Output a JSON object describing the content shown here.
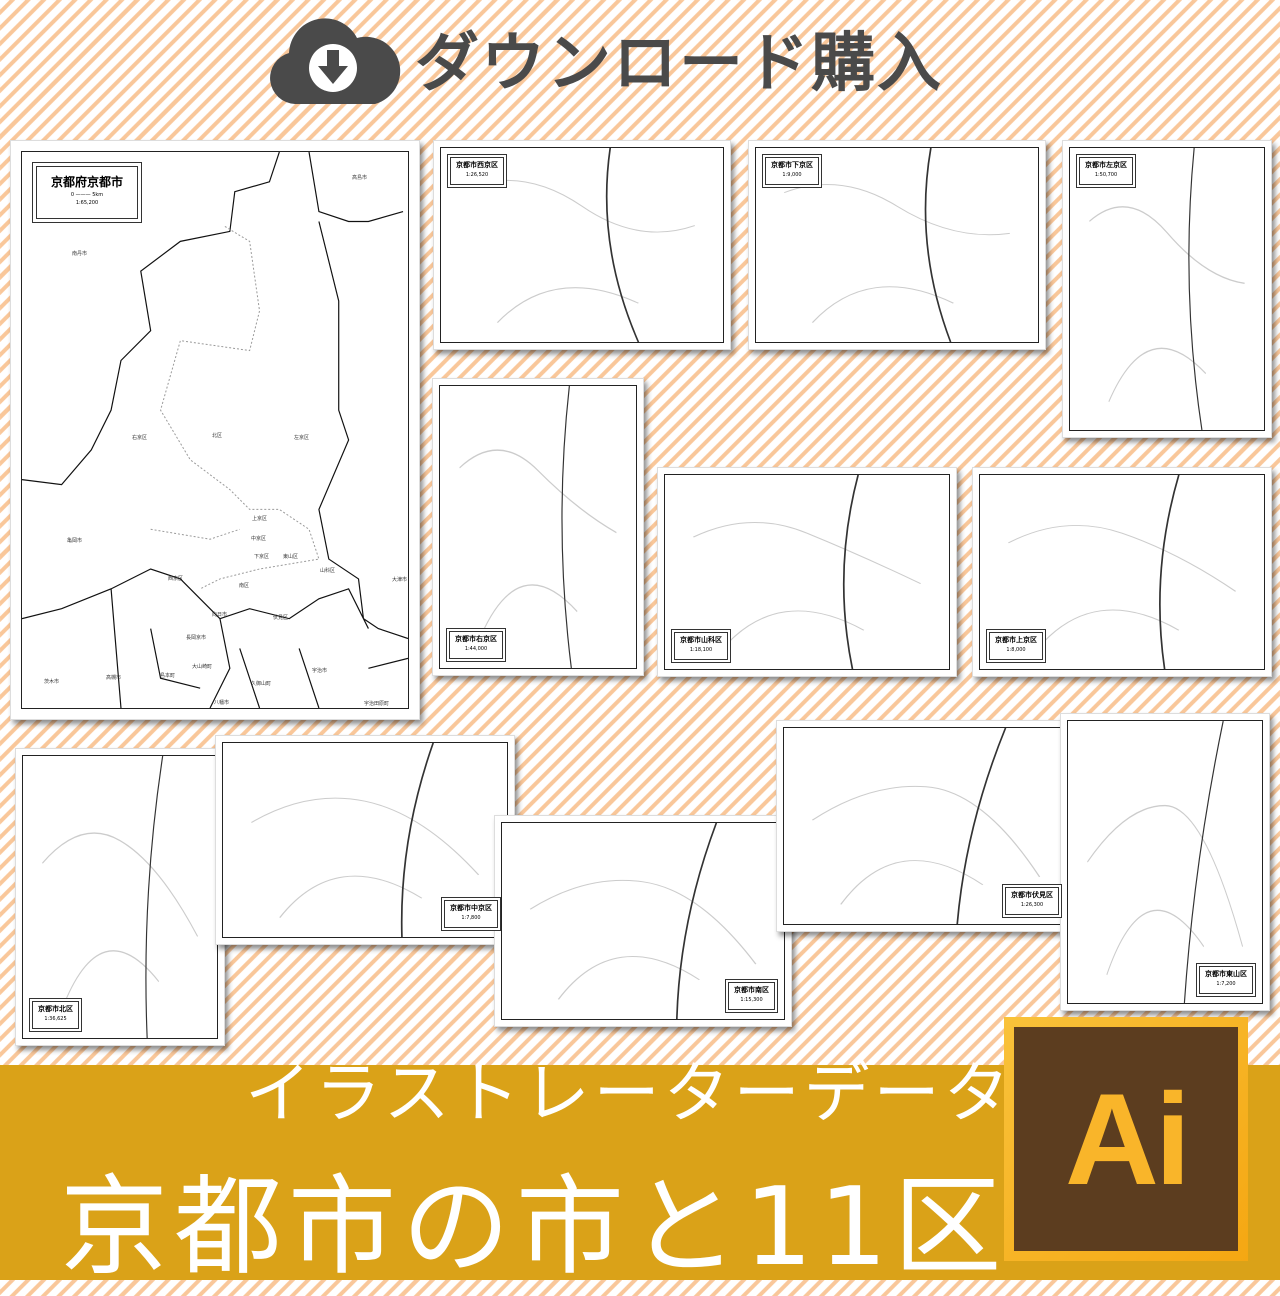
{
  "header": {
    "title": "ダウンロード購入",
    "icon": "cloud-download-icon"
  },
  "main_map": {
    "title": "京都府京都市",
    "scale": "1:65,200",
    "scale_start": "0",
    "scale_end": "5km",
    "labels": [
      [
        "南丹市",
        50,
        98
      ],
      [
        "高島市",
        330,
        22
      ],
      [
        "右京区",
        110,
        282
      ],
      [
        "北区",
        190,
        280
      ],
      [
        "左京区",
        272,
        282
      ],
      [
        "亀岡市",
        45,
        385
      ],
      [
        "上京区",
        230,
        363
      ],
      [
        "中京区",
        229,
        383
      ],
      [
        "下京区",
        232,
        401
      ],
      [
        "東山区",
        261,
        401
      ],
      [
        "山科区",
        298,
        415
      ],
      [
        "西京区",
        146,
        423
      ],
      [
        "南区",
        217,
        430
      ],
      [
        "大津市",
        370,
        424
      ],
      [
        "向日市",
        190,
        459
      ],
      [
        "伏見区",
        251,
        462
      ],
      [
        "長岡京市",
        164,
        482
      ],
      [
        "大山崎町",
        170,
        511
      ],
      [
        "島本町",
        138,
        520
      ],
      [
        "茨木市",
        22,
        526
      ],
      [
        "高槻市",
        84,
        522
      ],
      [
        "久御山町",
        229,
        528
      ],
      [
        "宇治市",
        290,
        515
      ],
      [
        "八幡市",
        192,
        547
      ],
      [
        "宇治田原町",
        342,
        548
      ]
    ]
  },
  "sheets": [
    {
      "title": "京都市西京区",
      "scale": "1:26,520"
    },
    {
      "title": "京都市下京区",
      "scale": "1:9,000"
    },
    {
      "title": "京都市左京区",
      "scale": "1:50,700"
    },
    {
      "title": "京都市右京区",
      "scale": "1:44,000"
    },
    {
      "title": "京都市山科区",
      "scale": "1:18,100"
    },
    {
      "title": "京都市上京区",
      "scale": "1:8,000"
    },
    {
      "title": "京都市北区",
      "scale": "1:36,625"
    },
    {
      "title": "京都市中京区",
      "scale": "1:7,800"
    },
    {
      "title": "京都市南区",
      "scale": "1:15,300"
    },
    {
      "title": "京都市伏見区",
      "scale": "1:26,300"
    },
    {
      "title": "京都市東山区",
      "scale": "1:7,200"
    }
  ],
  "banner": {
    "subtitle": "イラストレーターデータ",
    "title": "京都市の市と11区",
    "logo_text": "Ai"
  },
  "colors": {
    "stripe": "#f9c79a",
    "band": "#daa218",
    "header": "#4a4a4a",
    "ai_bg": "#5c3d1f",
    "ai_fg": "#f9b52a"
  }
}
